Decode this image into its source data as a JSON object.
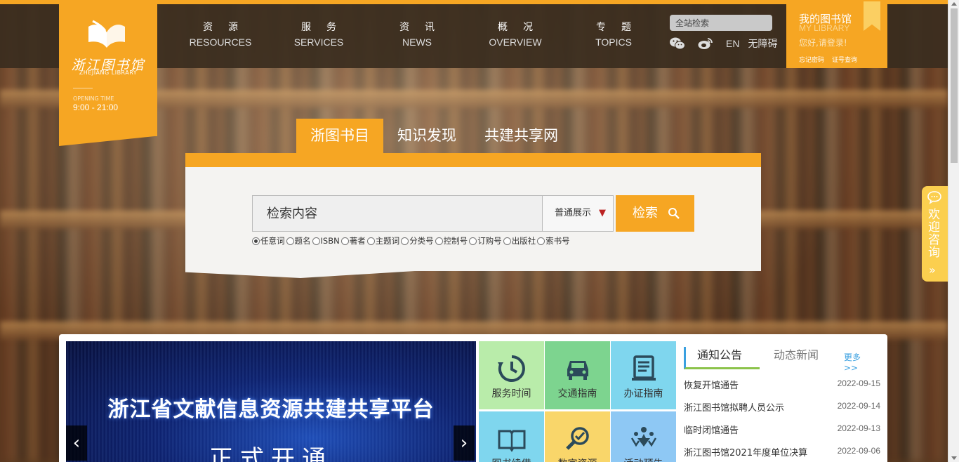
{
  "logo": {
    "name": "浙江图书馆",
    "name_en": "ZHEJIANG LIBRARY",
    "opening_label": "OPENING TIME",
    "opening_time": "9:00 - 21:00"
  },
  "nav": [
    {
      "cn": "资源",
      "en": "RESOURCES"
    },
    {
      "cn": "服务",
      "en": "SERVICES"
    },
    {
      "cn": "资讯",
      "en": "NEWS"
    },
    {
      "cn": "概况",
      "en": "OVERVIEW"
    },
    {
      "cn": "专题",
      "en": "TOPICS"
    }
  ],
  "header": {
    "site_search_placeholder": "全站检索",
    "lang": "EN",
    "accessibility": "无障碍",
    "icons": [
      "wechat-icon",
      "weibo-icon"
    ]
  },
  "my_library": {
    "title": "我的图书馆",
    "title_en": "MY LIBRARY",
    "greeting": "您好,请登录!",
    "forgot_password": "忘记密码",
    "card_query": "证号查询"
  },
  "search": {
    "tabs": [
      "浙图书目",
      "知识发现",
      "共建共享网"
    ],
    "active_tab": 0,
    "placeholder": "检索内容",
    "display_mode": "普通展示",
    "button": "检索",
    "fields": [
      "任意词",
      "题名",
      "ISBN",
      "著者",
      "主题词",
      "分类号",
      "控制号",
      "订购号",
      "出版社",
      "索书号"
    ],
    "selected_field": 0
  },
  "consult": {
    "label": "欢迎咨询",
    "arrow": "»"
  },
  "banner": {
    "title": "浙江省文献信息资源共建共享平台",
    "subtitle": "正式开通",
    "prev": "‹",
    "next": "›"
  },
  "tiles": [
    {
      "label": "服务时间",
      "icon": "clock-icon",
      "color": "#b9ecaa"
    },
    {
      "label": "交通指南",
      "icon": "car-icon",
      "color": "#7dd48f"
    },
    {
      "label": "办证指南",
      "icon": "id-card-icon",
      "color": "#7fd6ee"
    },
    {
      "label": "图书续借",
      "icon": "book-icon",
      "color": "#7fd6ee"
    },
    {
      "label": "数字资源",
      "icon": "search-globe-icon",
      "color": "#f9d66a"
    },
    {
      "label": "活动预告",
      "icon": "people-icon",
      "color": "#8ec8f4"
    }
  ],
  "notices": {
    "tab_active": "通知公告",
    "tab_other": "动态新闻",
    "more": "更多>>",
    "items": [
      {
        "title": "恢复开馆通告",
        "date": "2022-09-15"
      },
      {
        "title": "浙江图书馆拟聘人员公示",
        "date": "2022-09-14"
      },
      {
        "title": "临时闭馆通告",
        "date": "2022-09-13"
      },
      {
        "title": "浙江图书馆2021年度单位决算",
        "date": "2022-09-06"
      }
    ]
  },
  "colors": {
    "accent": "#f6a623",
    "header_bg": "#3a2c1e",
    "link_blue": "#3aa0e0"
  }
}
